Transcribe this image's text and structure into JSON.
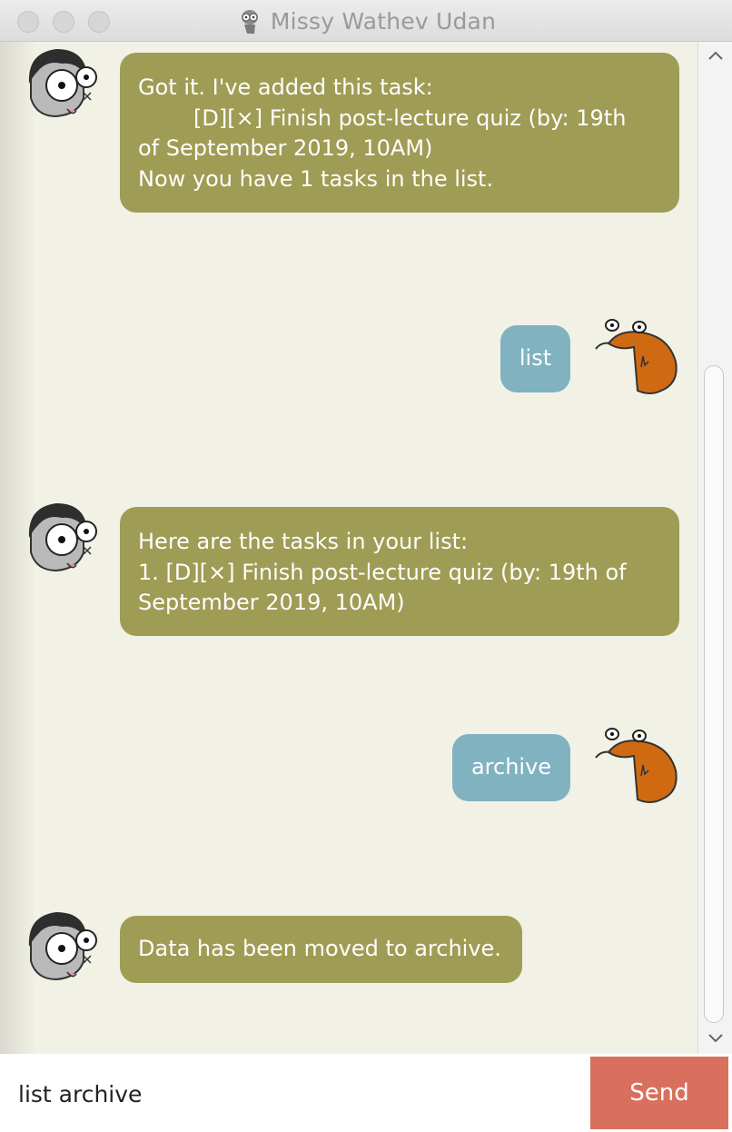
{
  "window": {
    "title": "Missy Wathev Udan"
  },
  "messages": [
    {
      "sender": "bot",
      "lines": [
        "Got it. I've added this task:",
        "        [D][×] Finish post-lecture quiz (by: 19th",
        "of September 2019, 10AM)",
        "Now you have 1 tasks in the list."
      ]
    },
    {
      "sender": "user",
      "text": "list"
    },
    {
      "sender": "bot",
      "lines": [
        "Here are the tasks in your list:",
        "1. [D][×] Finish post-lecture quiz (by: 19th of",
        "September 2019, 10AM)"
      ]
    },
    {
      "sender": "user",
      "text": "archive"
    },
    {
      "sender": "bot",
      "lines": [
        "Data has been moved to archive."
      ]
    }
  ],
  "input": {
    "value": "list archive"
  },
  "send_button": {
    "label": "Send"
  },
  "colors": {
    "bot_bubble": "#9f9c55",
    "user_bubble": "#80b2c0",
    "send_button": "#d9705d",
    "background": "#f2f1e6"
  },
  "avatars": {
    "bot": "gray-zombie-character-avatar",
    "user": "orange-creature-avatar"
  }
}
